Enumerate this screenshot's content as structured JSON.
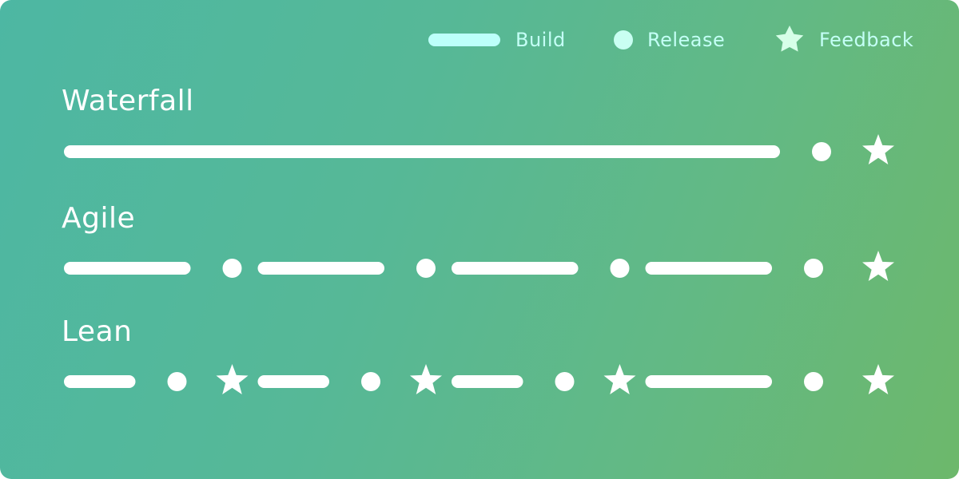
{
  "legend": [
    {
      "key": "build",
      "label": "Build",
      "icon": "bar-icon"
    },
    {
      "key": "release",
      "label": "Release",
      "icon": "dot-icon"
    },
    {
      "key": "feedback",
      "label": "Feedback",
      "icon": "star-icon"
    }
  ],
  "colors": {
    "background_start": "#4db7a3",
    "background_end": "#6db86b",
    "marks": "#ffffff",
    "legend_build": "#bcfffa",
    "legend_release": "#c9fff2",
    "legend_feedback": "#d6ffe8",
    "legend_text": "#c4fff6"
  },
  "rows": [
    {
      "name": "waterfall",
      "title": "Waterfall",
      "sequence": [
        "build",
        "release",
        "feedback"
      ],
      "build_cycles": 1
    },
    {
      "name": "agile",
      "title": "Agile",
      "sequence": [
        "build",
        "release",
        "build",
        "release",
        "build",
        "release",
        "build",
        "release",
        "feedback"
      ],
      "build_cycles": 4
    },
    {
      "name": "lean",
      "title": "Lean",
      "sequence": [
        "build",
        "release",
        "feedback",
        "build",
        "release",
        "feedback",
        "build",
        "release",
        "feedback",
        "build",
        "release",
        "feedback"
      ],
      "build_cycles": 4
    }
  ]
}
